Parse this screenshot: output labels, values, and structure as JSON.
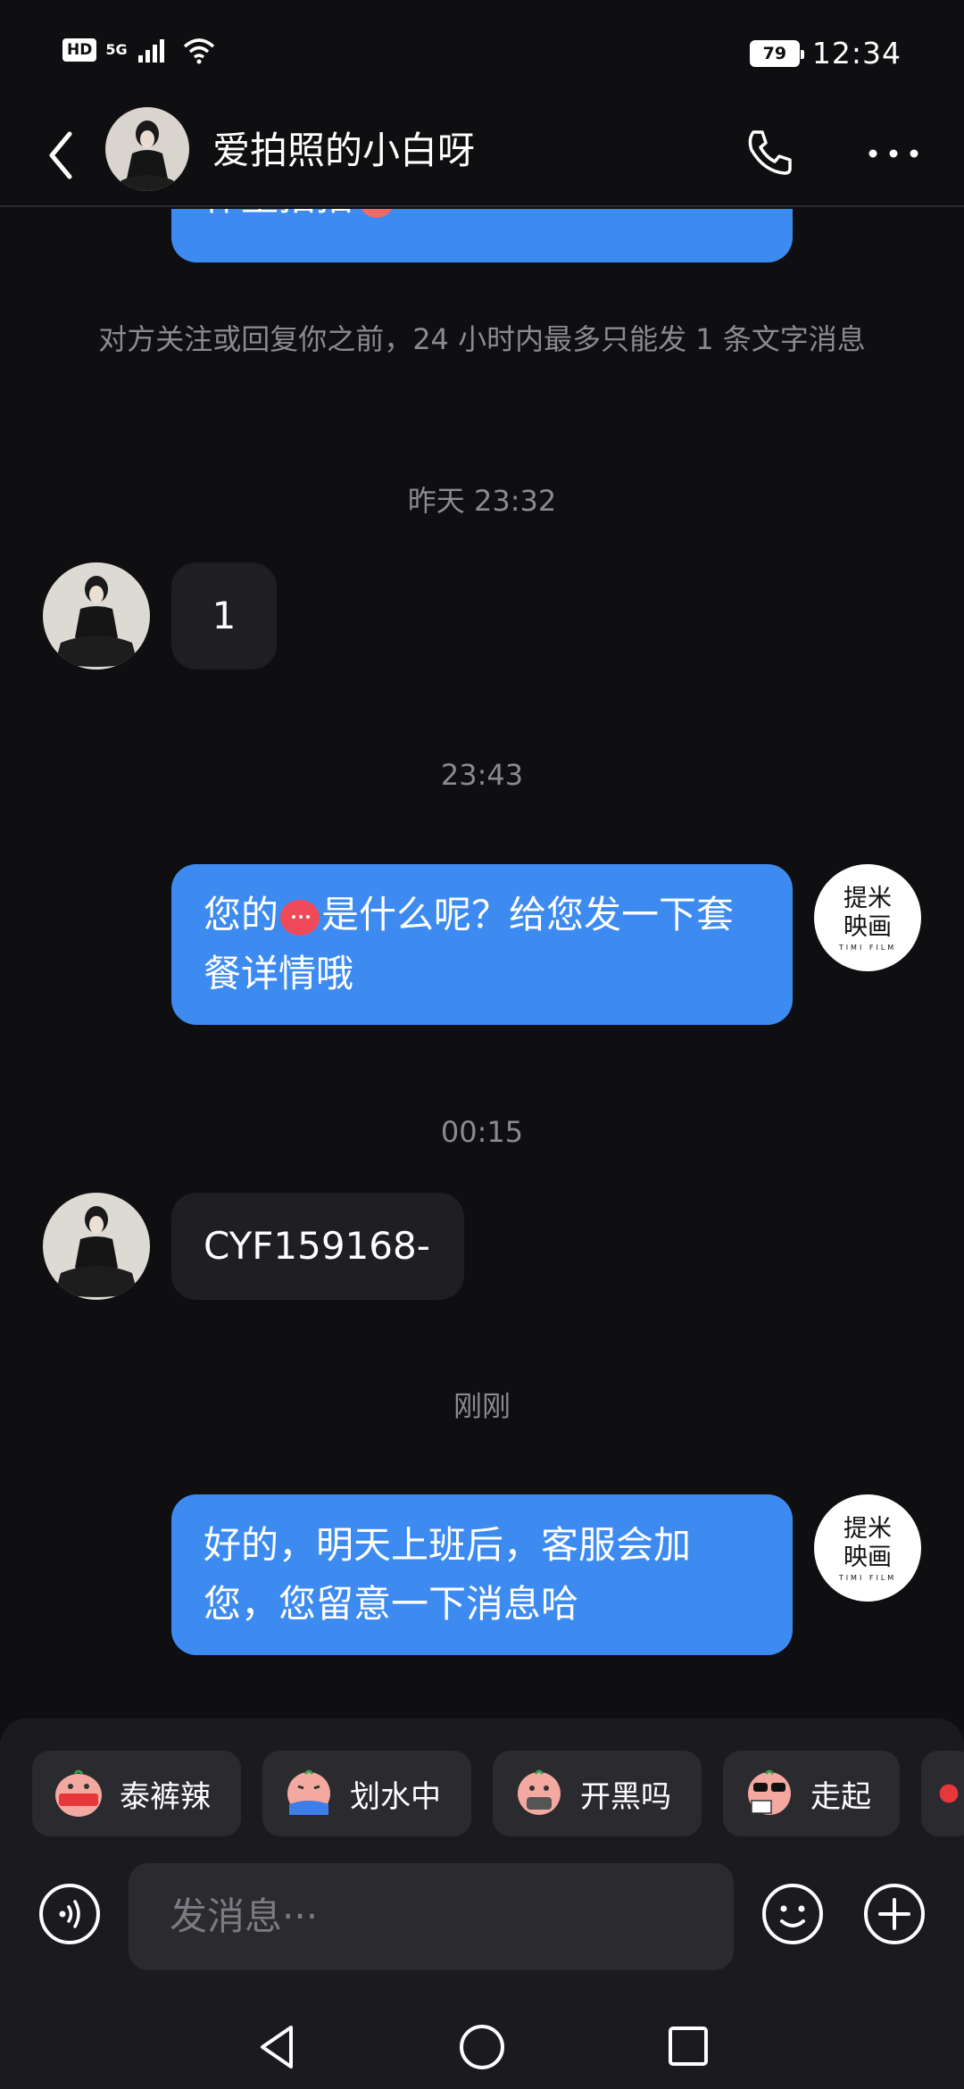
{
  "status": {
    "hd": "HD",
    "network": "5G",
    "battery": "79",
    "time": "12:34"
  },
  "header": {
    "title": "爱拍照的小白呀"
  },
  "chat": {
    "top_bubble_text": "作量拍拍",
    "notice": "对方关注或回复你之前，24 小时内最多只能发 1 条文字消息",
    "t1": "昨天 23:32",
    "msg1": "1",
    "t2": "23:43",
    "msg2_before": "您的",
    "msg2_after": "是什么呢？给您发一下套餐详情哦",
    "t3": "00:15",
    "msg3": "CYF159168-",
    "t4": "刚刚",
    "msg4": "好的，明天上班后，客服会加您，您留意一下消息哈",
    "brand_avatar": {
      "line1": "提米",
      "line2": "映画",
      "line3": "TIMI FILM"
    }
  },
  "quick_replies": [
    {
      "label": "泰裤辣",
      "icon": "cool-emoji-icon"
    },
    {
      "label": "划水中",
      "icon": "swimming-emoji-icon"
    },
    {
      "label": "开黑吗",
      "icon": "gaming-emoji-icon"
    },
    {
      "label": "走起",
      "icon": "sunglasses-emoji-icon"
    }
  ],
  "composer": {
    "placeholder": "发消息···"
  }
}
